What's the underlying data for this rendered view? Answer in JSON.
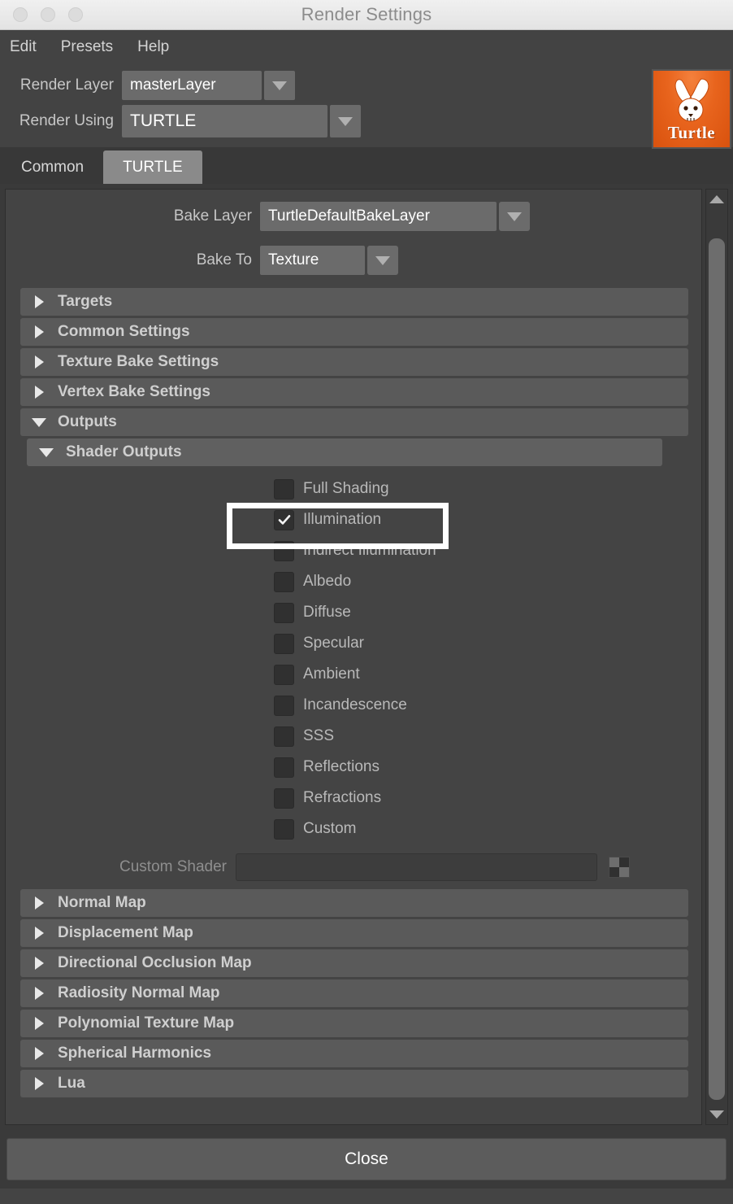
{
  "window": {
    "title": "Render Settings",
    "traffic_lights": [
      "close-button",
      "minimize-button",
      "zoom-button"
    ]
  },
  "menubar": {
    "items": [
      {
        "label": "Edit",
        "name": "menu-edit"
      },
      {
        "label": "Presets",
        "name": "menu-presets"
      },
      {
        "label": "Help",
        "name": "menu-help"
      }
    ]
  },
  "topform": {
    "render_layer": {
      "label": "Render Layer",
      "value": "masterLayer"
    },
    "render_using": {
      "label": "Render Using",
      "value": "TURTLE"
    },
    "logo": {
      "word": "Turtle",
      "icon": "turtle-rabbit-logo",
      "color": "#e8641d"
    }
  },
  "tabs": [
    {
      "label": "Common",
      "active": false
    },
    {
      "label": "TURTLE",
      "active": true
    }
  ],
  "panel": {
    "bake_layer": {
      "label": "Bake Layer",
      "value": "TurtleDefaultBakeLayer"
    },
    "bake_to": {
      "label": "Bake To",
      "value": "Texture"
    },
    "sections": [
      {
        "label": "Targets",
        "expanded": false,
        "level": 1
      },
      {
        "label": "Common Settings",
        "expanded": false,
        "level": 1
      },
      {
        "label": "Texture Bake Settings",
        "expanded": false,
        "level": 1
      },
      {
        "label": "Vertex Bake Settings",
        "expanded": false,
        "level": 1
      },
      {
        "label": "Outputs",
        "expanded": true,
        "level": 1
      },
      {
        "label": "Shader Outputs",
        "expanded": true,
        "level": 2
      }
    ],
    "shader_outputs": [
      {
        "label": "Full Shading",
        "checked": false
      },
      {
        "label": "Illumination",
        "checked": true
      },
      {
        "label": "Indirect Illumination",
        "checked": false
      },
      {
        "label": "Albedo",
        "checked": false
      },
      {
        "label": "Diffuse",
        "checked": false
      },
      {
        "label": "Specular",
        "checked": false
      },
      {
        "label": "Ambient",
        "checked": false
      },
      {
        "label": "Incandescence",
        "checked": false
      },
      {
        "label": "SSS",
        "checked": false
      },
      {
        "label": "Reflections",
        "checked": false
      },
      {
        "label": "Refractions",
        "checked": false
      },
      {
        "label": "Custom",
        "checked": false
      }
    ],
    "custom_shader": {
      "label": "Custom Shader",
      "value": "",
      "picker_icon": "checkerboard-icon"
    },
    "map_sections": [
      {
        "label": "Normal Map",
        "expanded": false
      },
      {
        "label": "Displacement Map",
        "expanded": false
      },
      {
        "label": "Directional Occlusion Map",
        "expanded": false
      },
      {
        "label": "Radiosity Normal Map",
        "expanded": false
      },
      {
        "label": "Polynomial Texture Map",
        "expanded": false
      },
      {
        "label": "Spherical Harmonics",
        "expanded": false
      },
      {
        "label": "Lua",
        "expanded": false
      }
    ]
  },
  "scrollbar": {
    "up_icon": "scroll-up-arrow",
    "down_icon": "scroll-down-arrow"
  },
  "footer": {
    "close_label": "Close"
  },
  "annotation": {
    "target": "Illumination",
    "color": "#ffffff"
  }
}
